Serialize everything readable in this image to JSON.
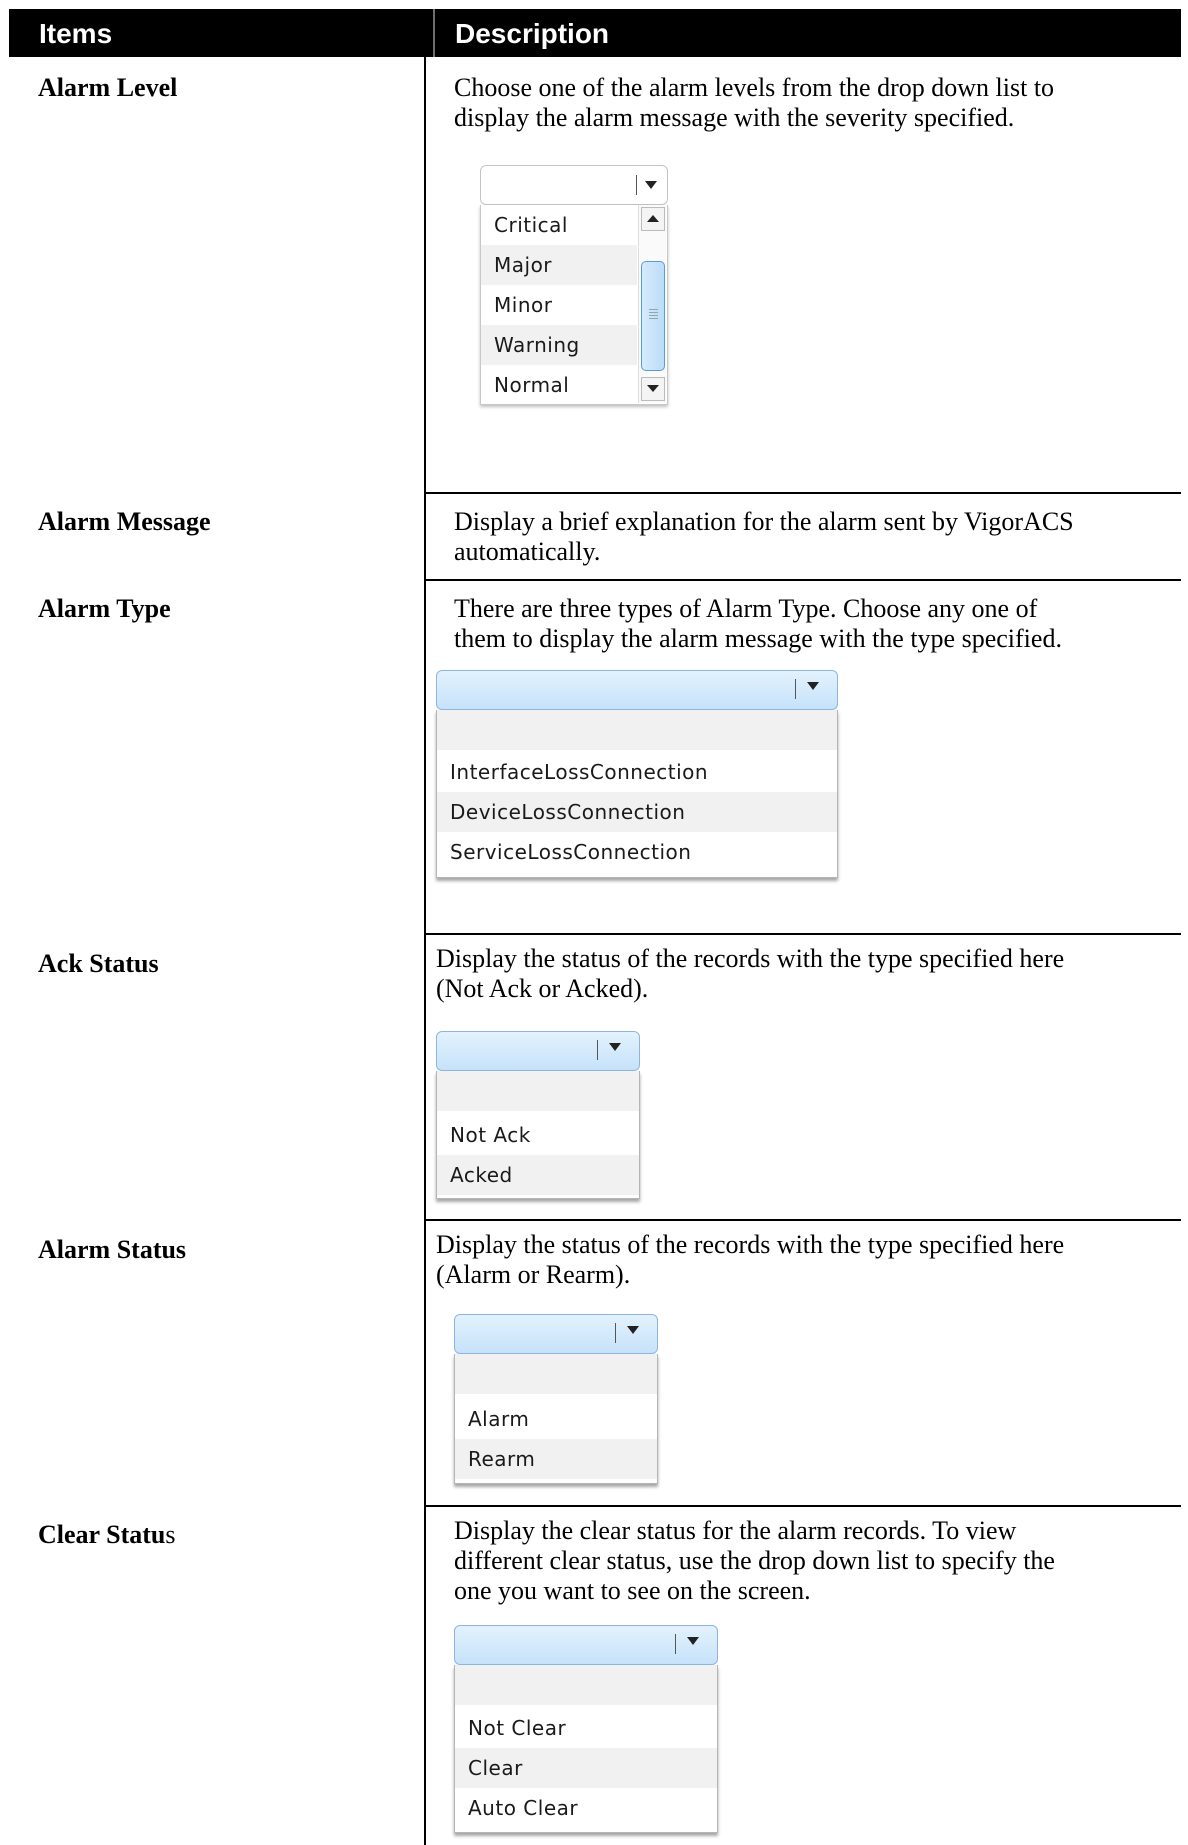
{
  "header": {
    "items": "Items",
    "description": "Description"
  },
  "rows": [
    {
      "item": "Alarm Level",
      "desc": [
        "Choose one of the alarm levels from the drop down list to",
        "display the alarm message with the severity specified."
      ],
      "options": [
        "Critical",
        "Major",
        "Minor",
        "Warning",
        "Normal"
      ]
    },
    {
      "item": "Alarm Message",
      "desc": [
        "Display a brief explanation for the alarm sent by VigorACS",
        "automatically."
      ]
    },
    {
      "item": "Alarm Type",
      "desc": [
        "There are three types of Alarm Type. Choose any one of",
        "them to display the alarm message with the type specified."
      ],
      "options": [
        "InterfaceLossConnection",
        "DeviceLossConnection",
        "ServiceLossConnection"
      ]
    },
    {
      "item": "Ack Status",
      "desc": [
        "Display the status of the records with the type specified here",
        "(Not Ack or Acked)."
      ],
      "options": [
        "Not Ack",
        "Acked"
      ]
    },
    {
      "item": "Alarm Status",
      "desc": [
        "Display the status of the records with the type specified here",
        "(Alarm or Rearm)."
      ],
      "options": [
        "Alarm",
        "Rearm"
      ]
    },
    {
      "item_bold": "Clear Statu",
      "item_rest": "s",
      "desc": [
        "Display the clear status for the alarm records. To view",
        "different clear status, use the drop down list to specify the",
        "one you want to see on the screen."
      ],
      "options": [
        "Not Clear",
        "Clear",
        "Auto Clear"
      ]
    }
  ]
}
